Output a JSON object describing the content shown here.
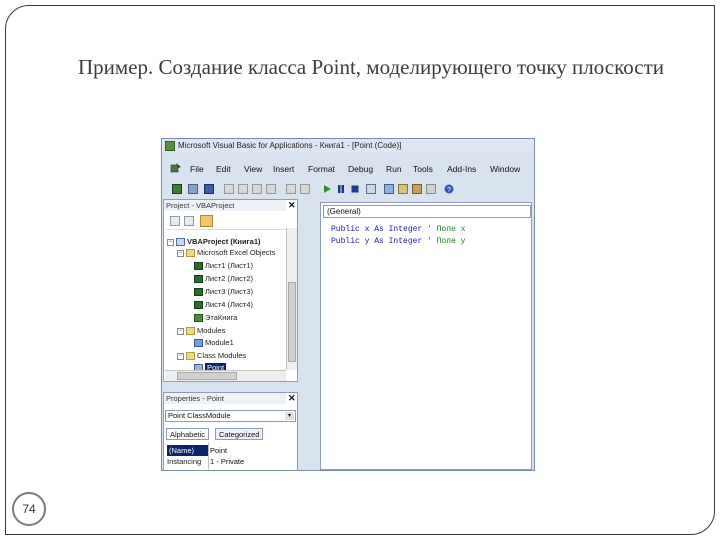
{
  "slide": {
    "title": "Пример. Создание класса Point, моделирующего точку плоскости",
    "page_number": "74"
  },
  "vbe": {
    "window_title": "Microsoft Visual Basic for Applications - Книга1 - [Point (Code)]",
    "menu": [
      "File",
      "Edit",
      "View",
      "Insert",
      "Format",
      "Debug",
      "Run",
      "Tools",
      "Add-Ins",
      "Window"
    ],
    "project_pane": {
      "title": "Project - VBAProject",
      "close": "✕",
      "tree": [
        {
          "label": "VBAProject (Книга1)",
          "level": 0,
          "kind": "project",
          "expander": "−"
        },
        {
          "label": "Microsoft Excel Objects",
          "level": 1,
          "kind": "folder",
          "expander": "−"
        },
        {
          "label": "Лист1 (Лист1)",
          "level": 2,
          "kind": "sheet"
        },
        {
          "label": "Лист2 (Лист2)",
          "level": 2,
          "kind": "sheet"
        },
        {
          "label": "Лист3 (Лист3)",
          "level": 2,
          "kind": "sheet"
        },
        {
          "label": "Лист4 (Лист4)",
          "level": 2,
          "kind": "sheet"
        },
        {
          "label": "ЭтаКнига",
          "level": 2,
          "kind": "workbook"
        },
        {
          "label": "Modules",
          "level": 1,
          "kind": "folder",
          "expander": "−"
        },
        {
          "label": "Module1",
          "level": 2,
          "kind": "module"
        },
        {
          "label": "Class Modules",
          "level": 1,
          "kind": "folder",
          "expander": "−"
        },
        {
          "label": "Point",
          "level": 2,
          "kind": "class",
          "selected": true
        }
      ]
    },
    "properties_pane": {
      "title": "Properties - Point",
      "close": "✕",
      "object_select": "Point ClassModule",
      "tabs": [
        "Alphabetic",
        "Categorized"
      ],
      "rows": [
        {
          "name": "(Name)",
          "value": "Point"
        },
        {
          "name": "Instancing",
          "value": "1 - Private"
        }
      ]
    },
    "code_pane": {
      "object_dropdown": "(General)",
      "lines": [
        {
          "code": "Public x As Integer ",
          "comment": "' Поле x"
        },
        {
          "code": "Public y As Integer ",
          "comment": "' Поле y"
        }
      ]
    },
    "colors": {
      "keyword": "#1a1aa0",
      "comment": "#1f7a1f",
      "selection": "#0a246a"
    }
  }
}
